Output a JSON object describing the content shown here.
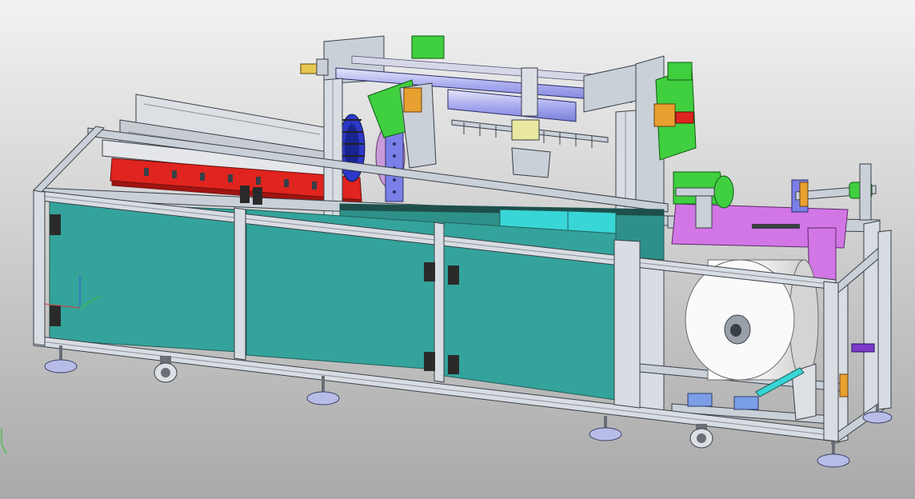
{
  "viewport": {
    "view_mode": "shaded-with-edges",
    "background": {
      "top": "#f2f2f2",
      "bottom": "#a9a9a9"
    }
  },
  "model": {
    "subject": "automated-packaging-machine",
    "colors": {
      "frame": "#c9d0d8",
      "frame_edge": "#3a3f46",
      "panel": "#34a39b",
      "panel_edge": "#1f5f5a",
      "red_rail": "#e0241f",
      "blue_part": "#7b7fe8",
      "dark_blue_wheel": "#2c38c8",
      "green_part": "#3fcf3f",
      "magenta_plate": "#d276e6",
      "cyan_part": "#38d6d6",
      "orange_part": "#e8a030",
      "roll_white": "#f4f4f4",
      "hinge": "#2a2a2a"
    }
  },
  "triad": {
    "x_axis_color": "#d04040",
    "y_axis_color": "#3fbf3f",
    "z_axis_color": "#4060d0"
  }
}
